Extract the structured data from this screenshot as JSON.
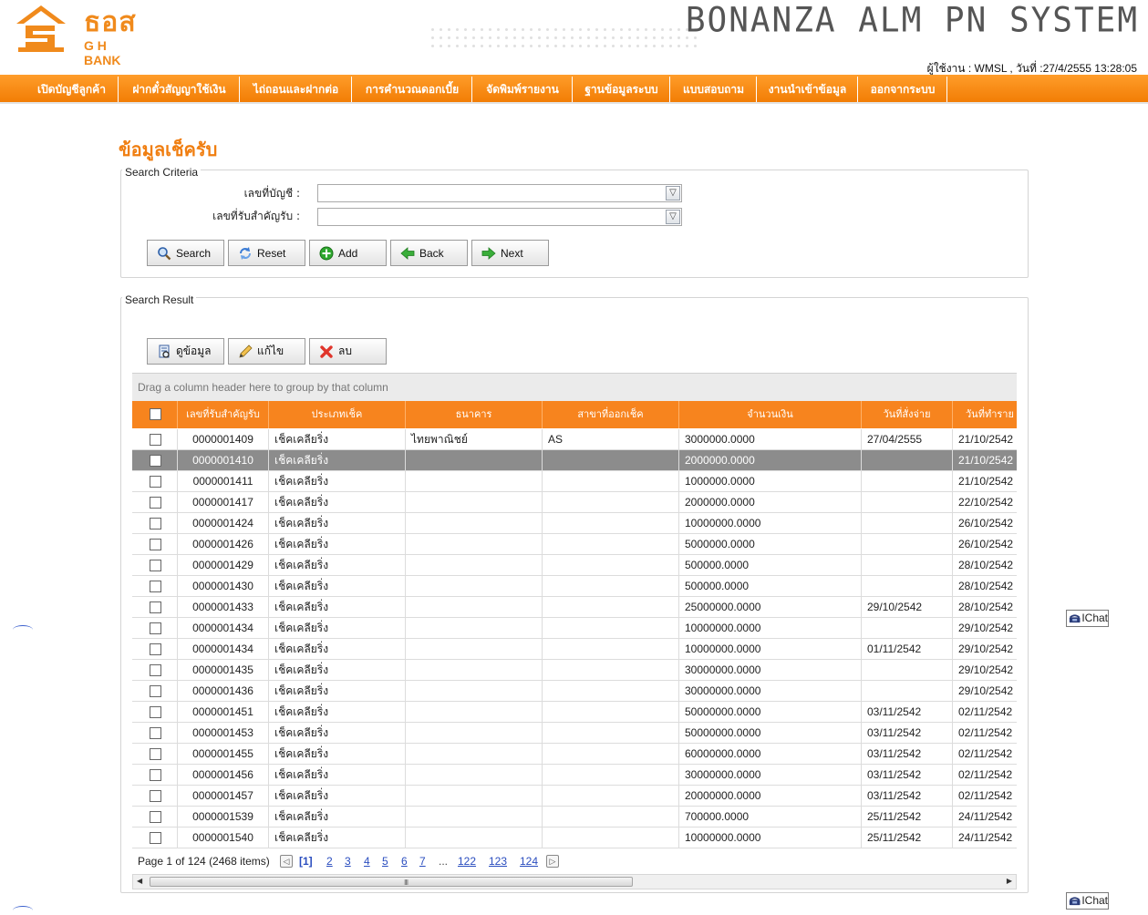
{
  "header": {
    "logo_text": "ธอส",
    "logo_sub": "G H BANK",
    "system_title": "BONANZA ALM PN SYSTEM",
    "user_info": "ผู้ใช้งาน : WMSL , วันที่ :27/4/2555 13:28:05"
  },
  "menu": [
    "เปิดบัญชีลูกค้า",
    "ฝากตั๋วสัญญาใช้เงิน",
    "ไถ่ถอนและฝากต่อ",
    "การคำนวณดอกเบี้ย",
    "จัดพิมพ์รายงาน",
    "ฐานข้อมูลระบบ",
    "แบบสอบถาม",
    "งานนำเข้าข้อมูล",
    "ออกจากระบบ"
  ],
  "page_title": "ข้อมูลเช็ครับ",
  "search_criteria": {
    "legend": "Search Criteria",
    "account_label": "เลขที่บัญชี :",
    "account_value": "",
    "receipt_label": "เลขที่รับสำคัญรับ :",
    "receipt_value": "",
    "buttons": {
      "search": "Search",
      "reset": "Reset",
      "add": "Add",
      "back": "Back",
      "next": "Next"
    }
  },
  "search_result": {
    "legend": "Search Result",
    "actions": {
      "view": "ดูข้อมูล",
      "edit": "แก้ไข",
      "delete": "ลบ"
    },
    "group_hint": "Drag a column header here to group by that column",
    "columns": [
      "เลขที่รับสำคัญรับ",
      "ประเภทเช็ค",
      "ธนาคาร",
      "สาขาที่ออกเช็ค",
      "จำนวนเงิน",
      "วันที่สั่งจ่าย",
      "วันที่ทำราย"
    ],
    "rows": [
      [
        "0000001409",
        "เช็คเคลียริ่ง",
        "ไทยพาณิชย์",
        "AS",
        "3000000.0000",
        "27/04/2555",
        "21/10/2542"
      ],
      [
        "0000001410",
        "เช็คเคลียริ่ง",
        "",
        "",
        "2000000.0000",
        "",
        "21/10/2542"
      ],
      [
        "0000001411",
        "เช็คเคลียริ่ง",
        "",
        "",
        "1000000.0000",
        "",
        "21/10/2542"
      ],
      [
        "0000001417",
        "เช็คเคลียริ่ง",
        "",
        "",
        "2000000.0000",
        "",
        "22/10/2542"
      ],
      [
        "0000001424",
        "เช็คเคลียริ่ง",
        "",
        "",
        "10000000.0000",
        "",
        "26/10/2542"
      ],
      [
        "0000001426",
        "เช็คเคลียริ่ง",
        "",
        "",
        "5000000.0000",
        "",
        "26/10/2542"
      ],
      [
        "0000001429",
        "เช็คเคลียริ่ง",
        "",
        "",
        "500000.0000",
        "",
        "28/10/2542"
      ],
      [
        "0000001430",
        "เช็คเคลียริ่ง",
        "",
        "",
        "500000.0000",
        "",
        "28/10/2542"
      ],
      [
        "0000001433",
        "เช็คเคลียริ่ง",
        "",
        "",
        "25000000.0000",
        "29/10/2542",
        "28/10/2542"
      ],
      [
        "0000001434",
        "เช็คเคลียริ่ง",
        "",
        "",
        "10000000.0000",
        "",
        "29/10/2542"
      ],
      [
        "0000001434",
        "เช็คเคลียริ่ง",
        "",
        "",
        "10000000.0000",
        "01/11/2542",
        "29/10/2542"
      ],
      [
        "0000001435",
        "เช็คเคลียริ่ง",
        "",
        "",
        "30000000.0000",
        "",
        "29/10/2542"
      ],
      [
        "0000001436",
        "เช็คเคลียริ่ง",
        "",
        "",
        "30000000.0000",
        "",
        "29/10/2542"
      ],
      [
        "0000001451",
        "เช็คเคลียริ่ง",
        "",
        "",
        "50000000.0000",
        "03/11/2542",
        "02/11/2542"
      ],
      [
        "0000001453",
        "เช็คเคลียริ่ง",
        "",
        "",
        "50000000.0000",
        "03/11/2542",
        "02/11/2542"
      ],
      [
        "0000001455",
        "เช็คเคลียริ่ง",
        "",
        "",
        "60000000.0000",
        "03/11/2542",
        "02/11/2542"
      ],
      [
        "0000001456",
        "เช็คเคลียริ่ง",
        "",
        "",
        "30000000.0000",
        "03/11/2542",
        "02/11/2542"
      ],
      [
        "0000001457",
        "เช็คเคลียริ่ง",
        "",
        "",
        "20000000.0000",
        "03/11/2542",
        "02/11/2542"
      ],
      [
        "0000001539",
        "เช็คเคลียริ่ง",
        "",
        "",
        "700000.0000",
        "25/11/2542",
        "24/11/2542"
      ],
      [
        "0000001540",
        "เช็คเคลียริ่ง",
        "",
        "",
        "10000000.0000",
        "25/11/2542",
        "24/11/2542"
      ]
    ],
    "selected_row": 1,
    "pager": {
      "summary": "Page 1 of 124 (2468 items)",
      "current": "[1]",
      "pages": [
        "2",
        "3",
        "4",
        "5",
        "6",
        "7",
        "...",
        "122",
        "123",
        "124"
      ],
      "prev_icon": "chevron-left-icon",
      "next_icon": "chevron-right-icon"
    },
    "scroll_grip": "III"
  },
  "ichat_label": "IChat",
  "colors": {
    "brand_orange": "#f7841e",
    "title_orange": "#f07e10",
    "selected_row": "#8c8c8c",
    "link_blue": "#2a4dbf"
  }
}
